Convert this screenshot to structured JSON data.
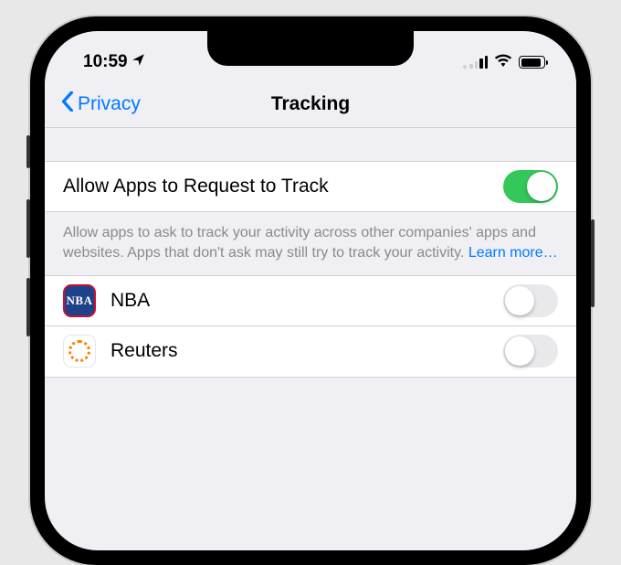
{
  "status": {
    "time": "10:59",
    "location_icon": "location-arrow",
    "signal": {
      "bars_active": 2,
      "bars_total": 4
    },
    "wifi": "wifi-full",
    "battery": "full"
  },
  "nav": {
    "back_label": "Privacy",
    "title": "Tracking"
  },
  "allow_request": {
    "label": "Allow Apps to Request to Track",
    "enabled": true,
    "footer": "Allow apps to ask to track your activity across other companies' apps and websites. Apps that don't ask may still try to track your activity. ",
    "learn_more": "Learn more…"
  },
  "apps": [
    {
      "icon": "nba",
      "icon_text": "NBA",
      "name": "NBA",
      "enabled": false
    },
    {
      "icon": "reuters",
      "icon_text": "",
      "name": "Reuters",
      "enabled": false
    }
  ],
  "colors": {
    "ios_blue": "#007aff",
    "switch_green": "#34c759",
    "nba_blue": "#1d428a",
    "nba_red": "#c8102e",
    "reuters_orange": "#ff8000"
  }
}
